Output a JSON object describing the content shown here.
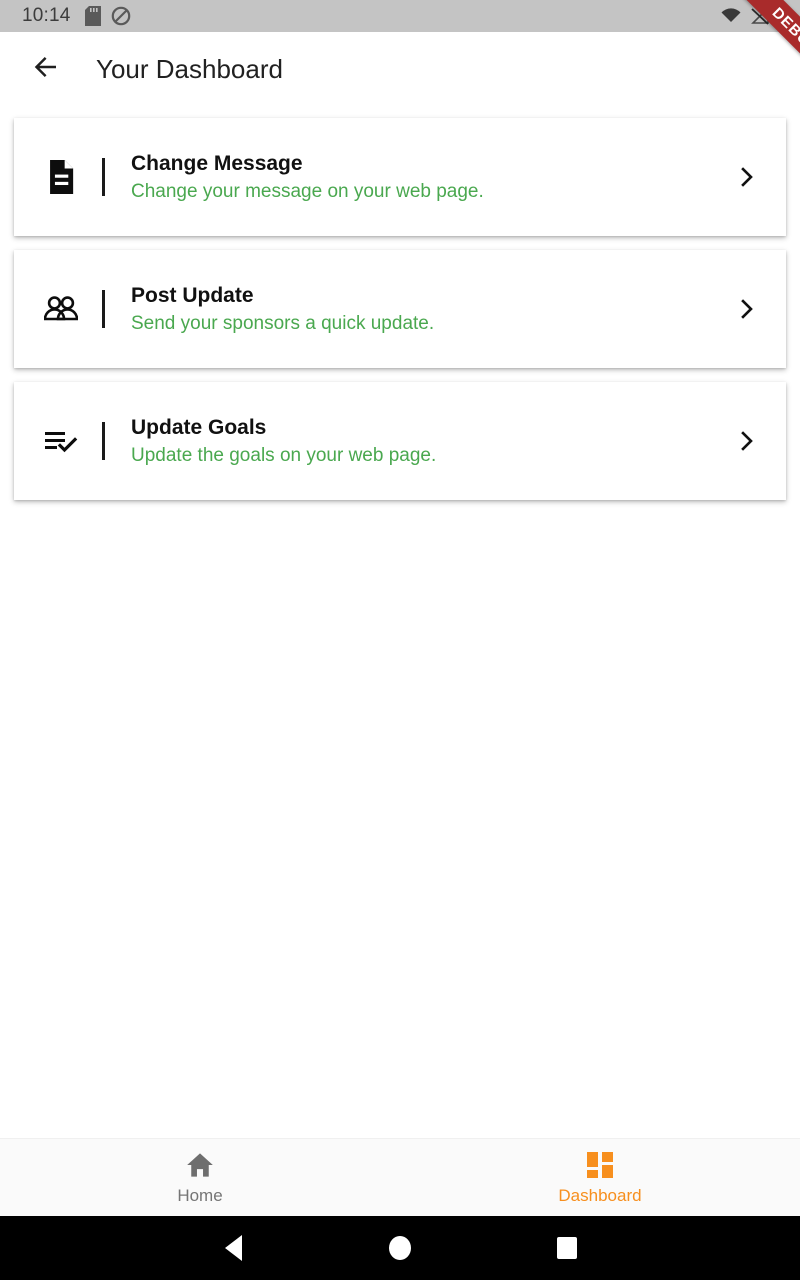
{
  "status_bar": {
    "time": "10:14",
    "left_icons": [
      "sd-card-icon",
      "do-not-disturb-icon"
    ],
    "right_icons": [
      "wifi-off-icon",
      "signal-off-icon",
      "battery-icon"
    ],
    "background": "#c4c4c4"
  },
  "debug_ribbon": {
    "label": "DEBUG",
    "color": "#a92b2b"
  },
  "app_bar": {
    "back_icon": "arrow-back-icon",
    "title": "Your Dashboard"
  },
  "cards": [
    {
      "icon": "document-icon",
      "title": "Change Message",
      "subtitle": "Change your message on your web page.",
      "chevron": "chevron-right-icon"
    },
    {
      "icon": "people-icon",
      "title": "Post Update",
      "subtitle": "Send your sponsors a quick update.",
      "chevron": "chevron-right-icon"
    },
    {
      "icon": "playlist-check-icon",
      "title": "Update Goals",
      "subtitle": "Update the goals on your web page.",
      "chevron": "chevron-right-icon"
    }
  ],
  "bottom_nav": {
    "items": [
      {
        "label": "Home",
        "icon": "home-icon",
        "active": false
      },
      {
        "label": "Dashboard",
        "icon": "dashboard-grid-icon",
        "active": true
      }
    ],
    "active_color": "#f78f1e",
    "inactive_color": "#757575"
  },
  "system_nav": {
    "back": "system-back-icon",
    "home": "system-home-icon",
    "recents": "system-recents-icon"
  },
  "colors": {
    "subtitle_green": "#4aa84f",
    "accent_orange": "#f78f1e",
    "title_dark": "#212121"
  }
}
